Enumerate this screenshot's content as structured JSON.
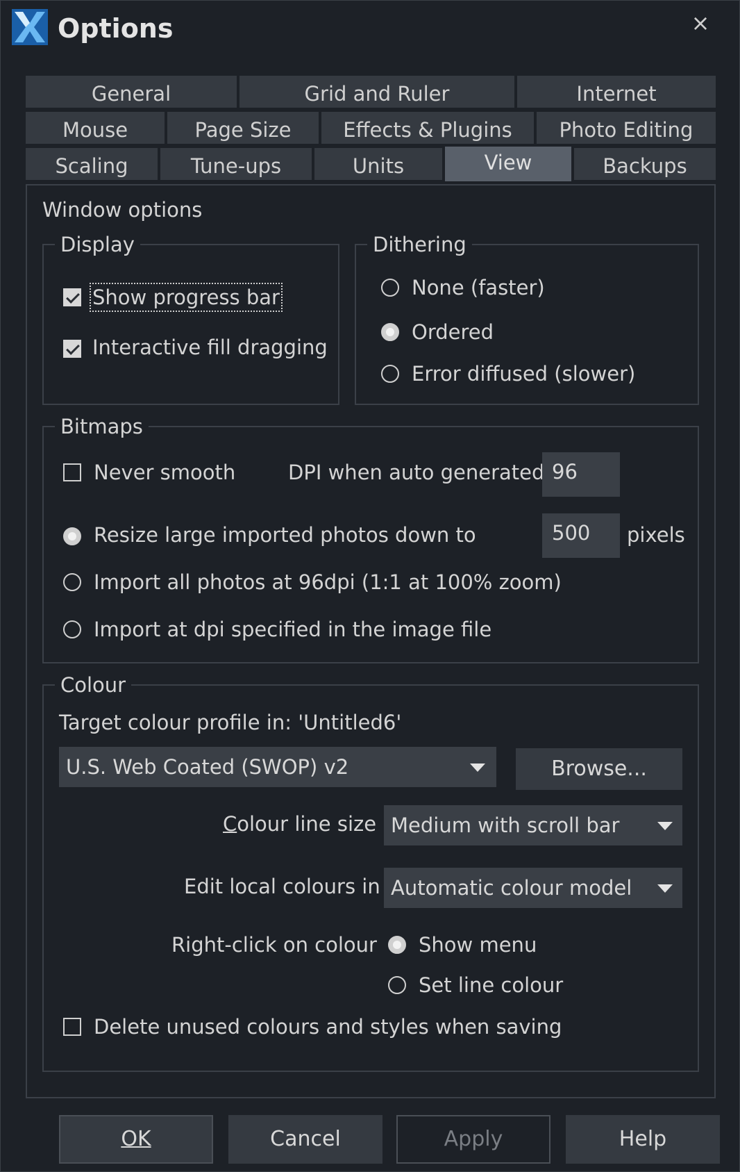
{
  "window": {
    "title": "Options",
    "close_glyph": "×"
  },
  "tabs": {
    "row1": [
      "General",
      "Grid and Ruler",
      "Internet"
    ],
    "row2": [
      "Mouse",
      "Page Size",
      "Effects & Plugins",
      "Photo Editing"
    ],
    "row3": [
      "Scaling",
      "Tune-ups",
      "Units",
      "View",
      "Backups"
    ],
    "active": "View"
  },
  "window_options": {
    "heading": "Window options",
    "display": {
      "legend": "Display",
      "show_progress_bar": {
        "label": "Show progress bar",
        "checked": true
      },
      "interactive_fill_dragging": {
        "label": "Interactive fill dragging",
        "checked": true
      }
    },
    "dithering": {
      "legend": "Dithering",
      "options": [
        "None (faster)",
        "Ordered",
        "Error diffused (slower)"
      ],
      "selected": "Ordered"
    }
  },
  "bitmaps": {
    "legend": "Bitmaps",
    "never_smooth": {
      "label": "Never smooth",
      "checked": false
    },
    "dpi_label": "DPI when auto generated",
    "dpi_value": "96",
    "resize_label": "Resize large imported photos down to",
    "resize_value": "500",
    "pixels_label": "pixels",
    "import_96_label": "Import all photos at 96dpi (1:1 at 100% zoom)",
    "import_file_label": "Import at dpi specified in the image file",
    "selected": "Resize large imported photos down to"
  },
  "colour": {
    "legend": "Colour",
    "target_profile_label": "Target colour profile in: 'Untitled6'",
    "profile_value": "U.S. Web Coated (SWOP) v2",
    "browse_label": "Browse...",
    "line_size_label": "Colour line size",
    "line_size_value": "Medium with scroll bar",
    "edit_local_label": "Edit local colours in",
    "edit_local_value": "Automatic colour model",
    "right_click_label": "Right-click on colour",
    "right_click_options": [
      "Show menu",
      "Set line colour"
    ],
    "right_click_selected": "Show menu",
    "delete_unused": {
      "label": "Delete unused colours and styles when saving",
      "checked": false
    }
  },
  "buttons": {
    "ok": "OK",
    "cancel": "Cancel",
    "apply": "Apply",
    "help": "Help"
  },
  "colors": {
    "background": "#1d2127",
    "tab": "#353a41",
    "tab_active": "#59606a",
    "field": "#3a3f46",
    "logo": "#2f8fe0"
  }
}
